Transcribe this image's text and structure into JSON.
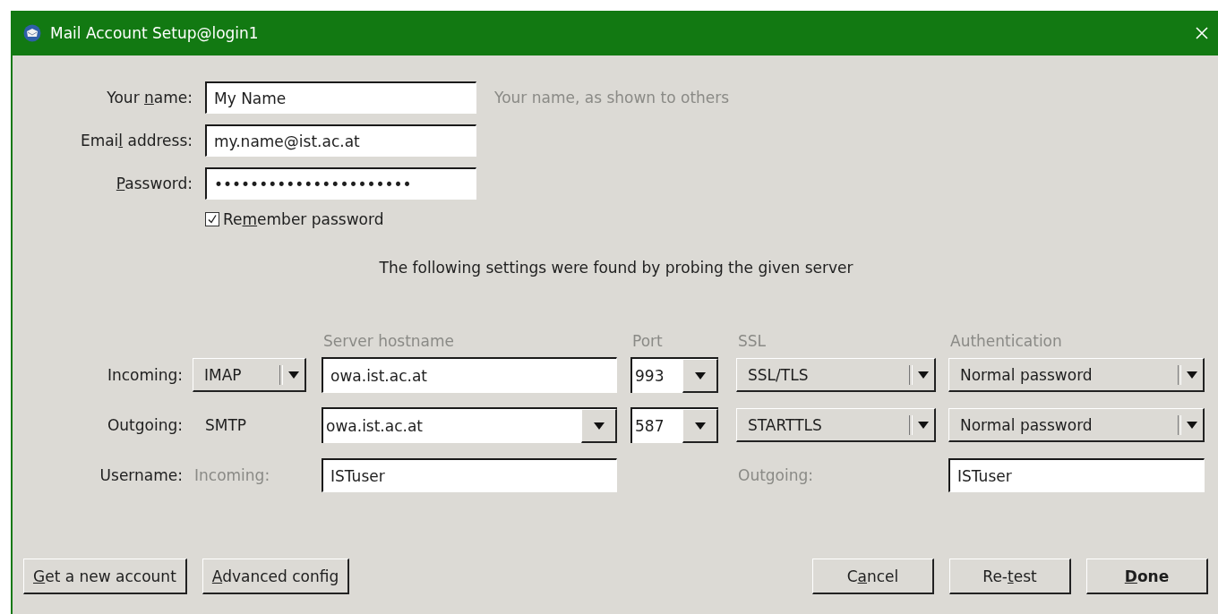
{
  "window": {
    "title": "Mail Account Setup@login1"
  },
  "identity": [
    {
      "label": {
        "before": "Your ",
        "key": "n",
        "after": "ame:"
      },
      "value": "My Name",
      "hint": "Your name, as shown to others"
    },
    {
      "label": {
        "before": "Emai",
        "key": "l",
        "after": " address:"
      },
      "value": "my.name@ist.ac.at"
    },
    {
      "label": {
        "key": "P",
        "after": "assword:"
      },
      "value": "••••••••••••••••••••••"
    }
  ],
  "remember_password": {
    "label": {
      "before": "Re",
      "key": "m",
      "after": "ember password"
    },
    "checked": true
  },
  "probe_message": "The following settings were found by probing the given server",
  "server_columns": [
    "Server hostname",
    "Port",
    "SSL",
    "Authentication"
  ],
  "incoming": {
    "label": "Incoming:",
    "protocol": "IMAP",
    "hostname": "owa.ist.ac.at",
    "port": "993",
    "ssl": "SSL/TLS",
    "authentication": "Normal password"
  },
  "outgoing": {
    "label": "Outgoing:",
    "protocol": "SMTP",
    "hostname": "owa.ist.ac.at",
    "port": "587",
    "ssl": "STARTTLS",
    "authentication": "Normal password"
  },
  "username": {
    "label": "Username:",
    "incoming_label": "Incoming:",
    "incoming": "ISTuser",
    "outgoing_label": "Outgoing:",
    "outgoing": "ISTuser"
  },
  "buttons_left": [
    {
      "label": {
        "key": "G",
        "after": "et a new account"
      },
      "default": false
    },
    {
      "label": {
        "key": "A",
        "after": "dvanced config"
      },
      "default": false
    }
  ],
  "buttons_right": [
    {
      "label": {
        "before": "C",
        "key": "a",
        "after": "ncel"
      },
      "default": false
    },
    {
      "label": {
        "before": "Re-",
        "key": "t",
        "after": "est"
      },
      "default": false
    },
    {
      "label": {
        "key": "D",
        "after": "one"
      },
      "default": true
    }
  ]
}
